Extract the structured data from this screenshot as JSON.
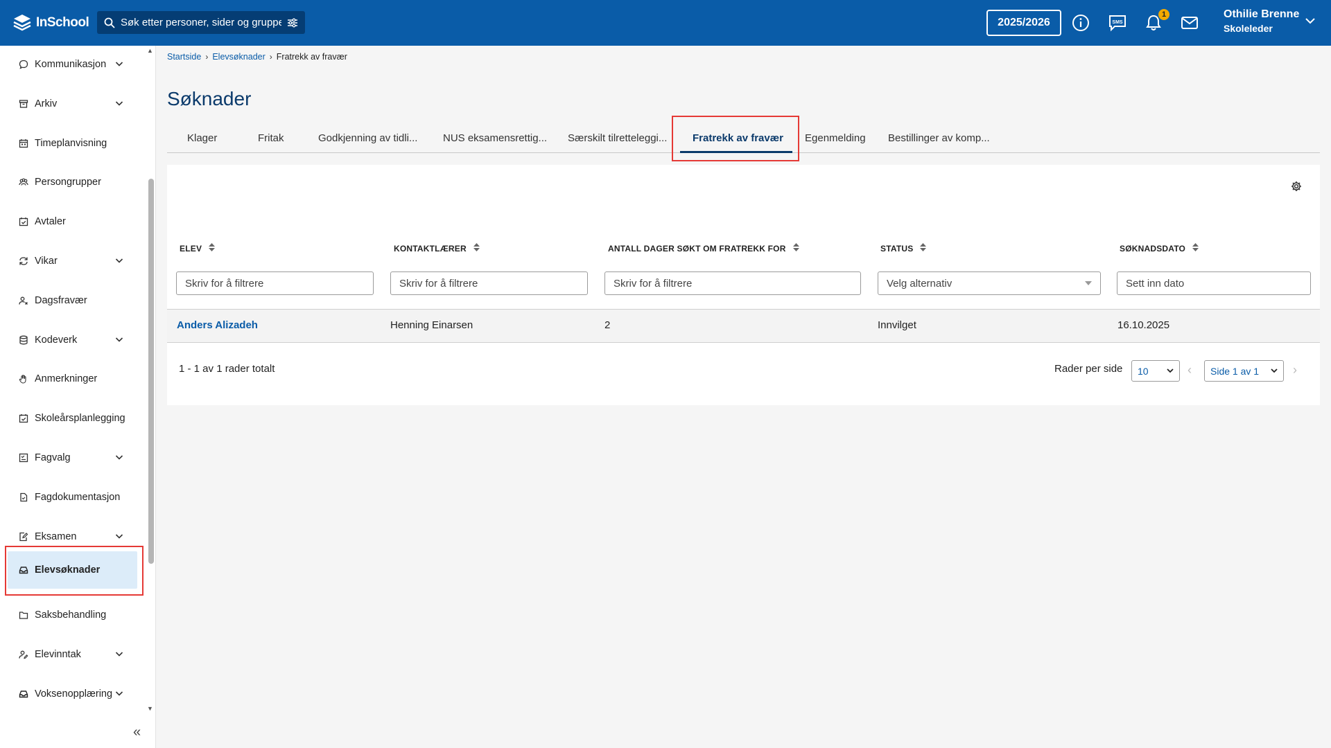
{
  "header": {
    "logo_text": "InSchool",
    "search_placeholder": "Søk etter personer, sider og grupper",
    "school_year": "2025/2026",
    "notification_count": "1",
    "user_name": "Othilie Brenne",
    "user_role": "Skoleleder",
    "icons": [
      "info-icon",
      "sms-icon",
      "bell-icon",
      "mail-icon"
    ]
  },
  "sidebar": {
    "items": [
      {
        "label": "Kommunikasjon",
        "icon": "chat-icon",
        "expandable": true
      },
      {
        "label": "Arkiv",
        "icon": "archive-icon",
        "expandable": true
      },
      {
        "label": "Timeplanvisning",
        "icon": "calendar-icon",
        "expandable": false
      },
      {
        "label": "Persongrupper",
        "icon": "people-icon",
        "expandable": false
      },
      {
        "label": "Avtaler",
        "icon": "calendar-check-icon",
        "expandable": false
      },
      {
        "label": "Vikar",
        "icon": "swap-icon",
        "expandable": true
      },
      {
        "label": "Dagsfravær",
        "icon": "person-x-icon",
        "expandable": false
      },
      {
        "label": "Kodeverk",
        "icon": "database-icon",
        "expandable": true
      },
      {
        "label": "Anmerkninger",
        "icon": "hand-icon",
        "expandable": false
      },
      {
        "label": "Skoleårsplanlegging",
        "icon": "calendar-check-icon",
        "expandable": false
      },
      {
        "label": "Fagvalg",
        "icon": "checklist-icon",
        "expandable": true
      },
      {
        "label": "Fagdokumentasjon",
        "icon": "document-icon",
        "expandable": false
      },
      {
        "label": "Eksamen",
        "icon": "edit-doc-icon",
        "expandable": true
      },
      {
        "label": "Elevsøknader",
        "icon": "inbox-icon",
        "expandable": false,
        "active": true
      },
      {
        "label": "Saksbehandling",
        "icon": "folder-icon",
        "expandable": false
      },
      {
        "label": "Elevinntak",
        "icon": "person-edit-icon",
        "expandable": true
      },
      {
        "label": "Voksenopplæring",
        "icon": "inbox-icon",
        "expandable": true
      }
    ]
  },
  "breadcrumb": [
    "Startside",
    "Elevsøknader",
    "Fratrekk av fravær"
  ],
  "page_title": "Søknader",
  "tabs": [
    "Klager",
    "Fritak",
    "Godkjenning av tidli...",
    "NUS eksamensrettig...",
    "Særskilt tilretteleggi...",
    "Fratrekk av fravær",
    "Egenmelding",
    "Bestillinger av komp..."
  ],
  "active_tab": "Fratrekk av fravær",
  "table": {
    "columns": [
      "ELEV",
      "KONTAKTLÆRER",
      "ANTALL DAGER SØKT OM FRATREKK FOR",
      "STATUS",
      "SØKNADSDATO"
    ],
    "filters": [
      "Skriv for å filtrere",
      "Skriv for å filtrere",
      "Skriv for å filtrere",
      "Velg alternativ",
      "Sett inn dato"
    ],
    "rows": [
      {
        "elev": "Anders Alizadeh",
        "kontaktlaerer": "Henning Einarsen",
        "dager": "2",
        "status": "Innvilget",
        "dato": "16.10.2025"
      }
    ]
  },
  "pagination": {
    "total_text": "1 - 1 av 1 rader totalt",
    "rows_per_page_label": "Rader per side",
    "rows_per_page": "10",
    "page_text": "Side 1 av 1"
  },
  "colors": {
    "header_bg": "#0a5ca8",
    "active_bg": "#dcecf9",
    "highlight": "#e53935",
    "title": "#0b3a6b"
  }
}
